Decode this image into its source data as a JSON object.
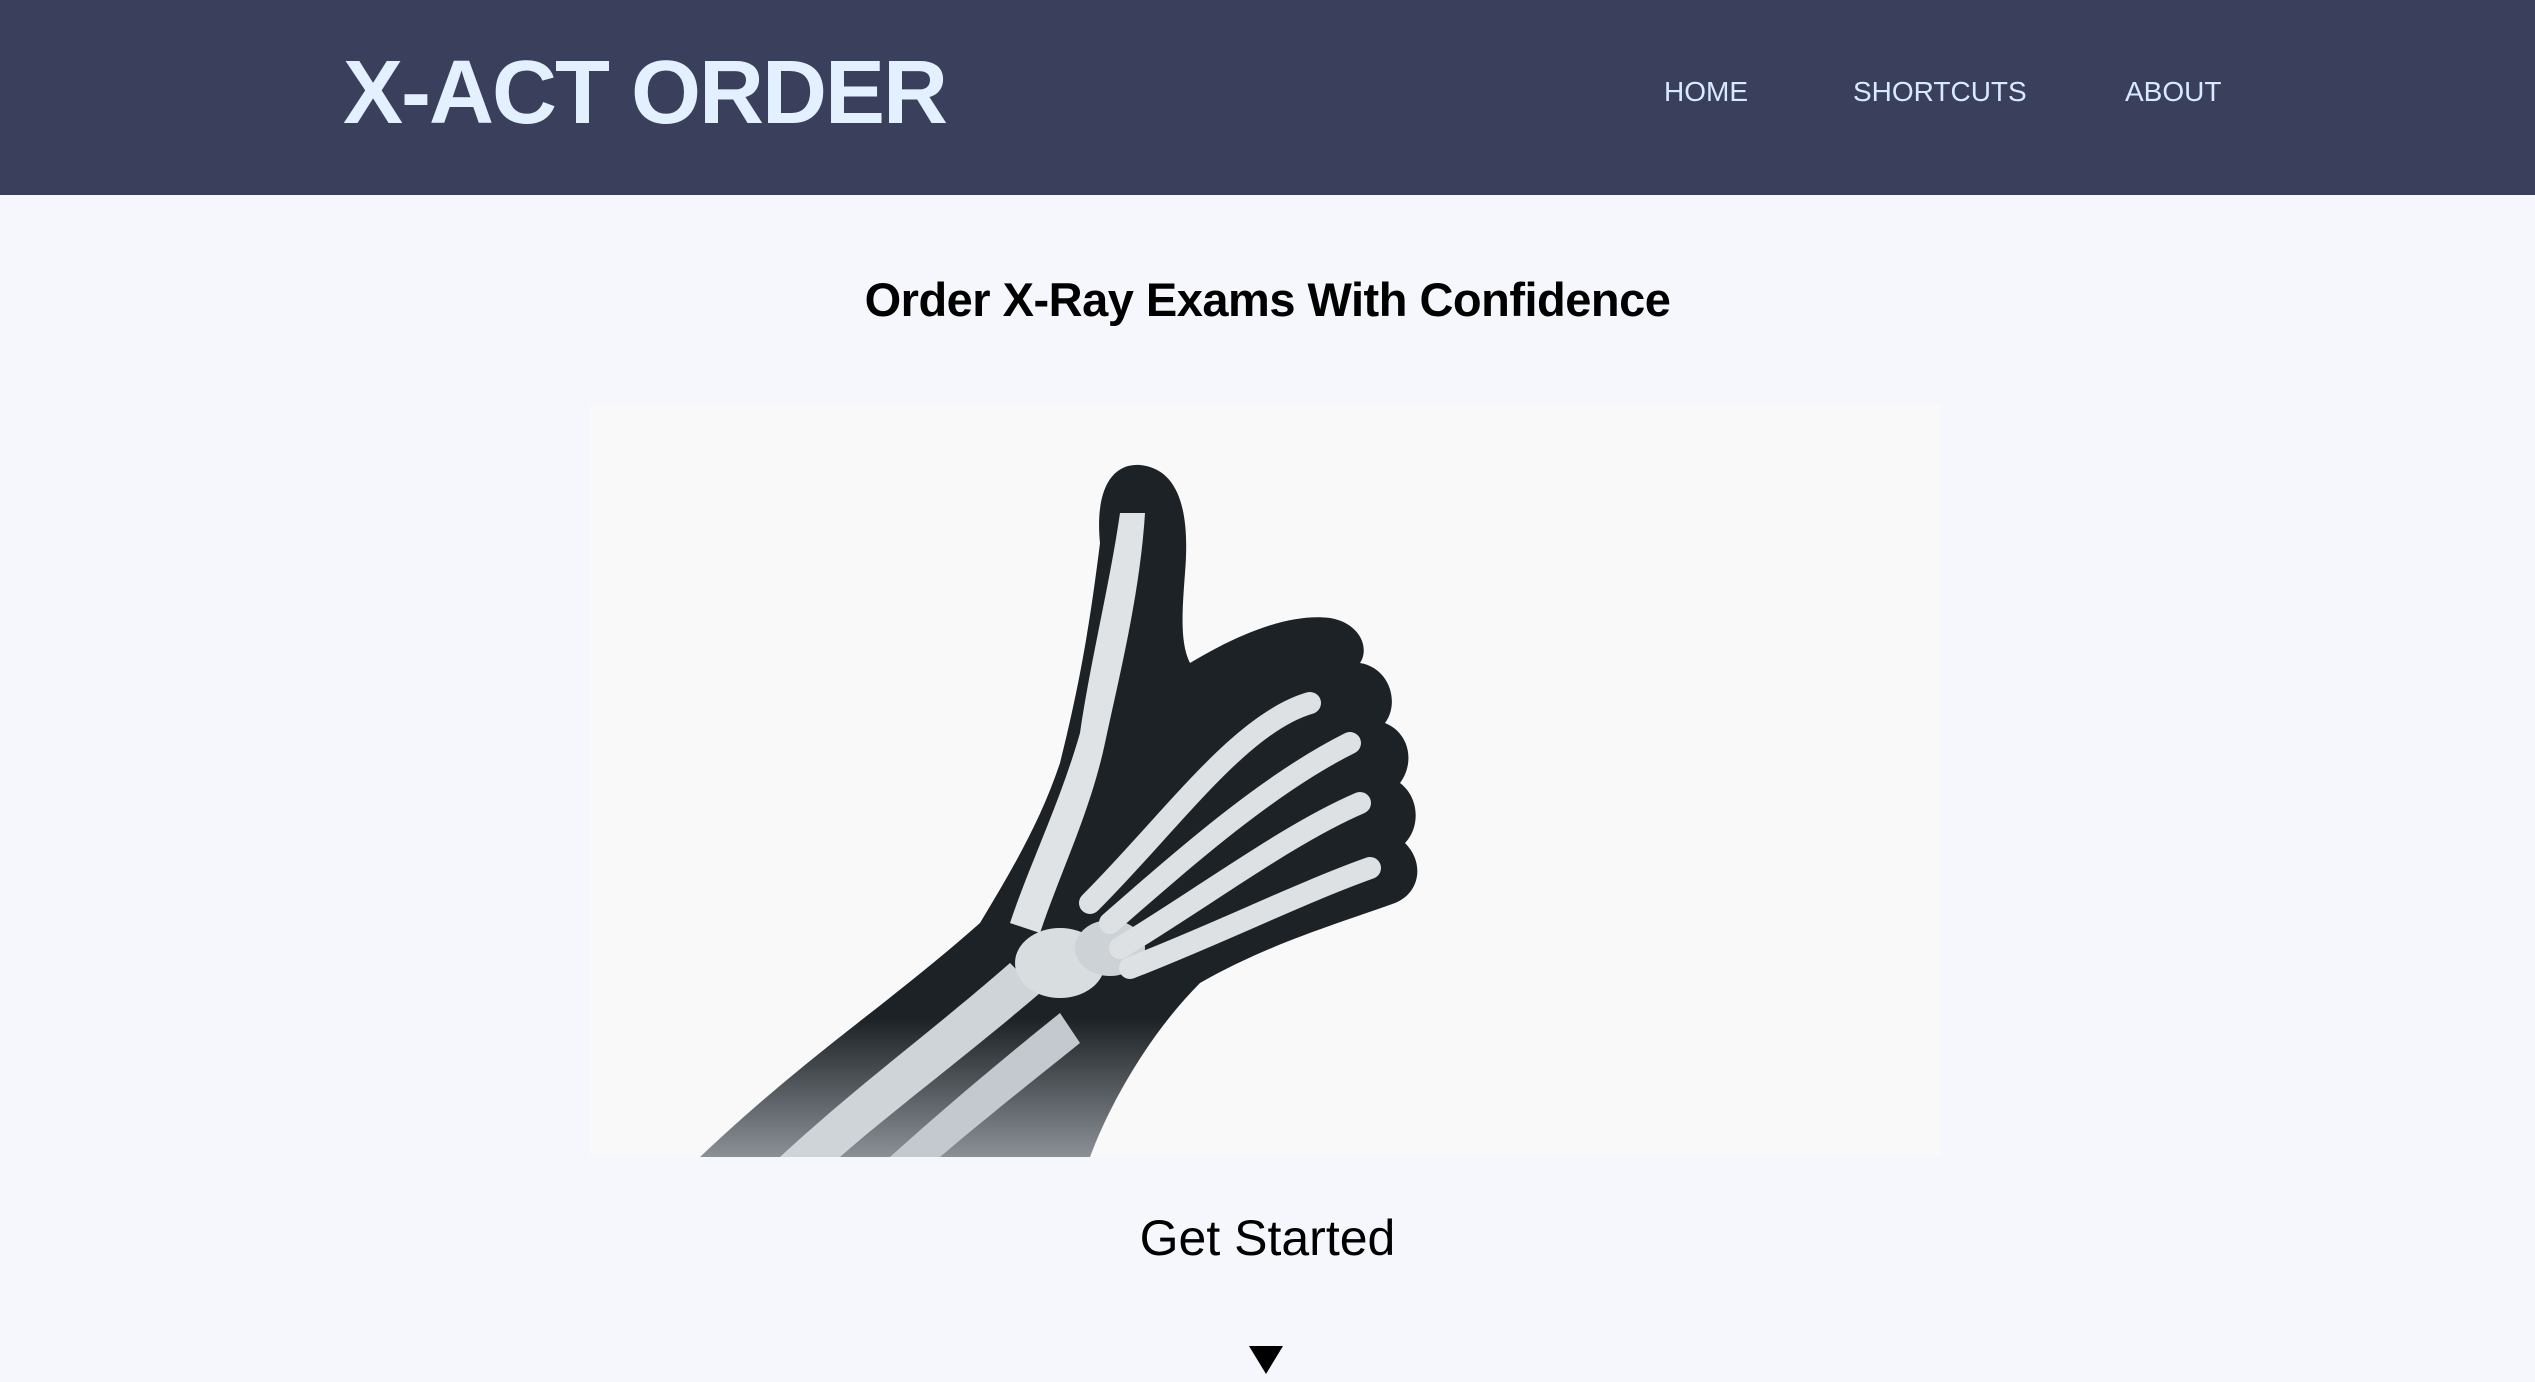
{
  "header": {
    "logo": "X-ACT ORDER",
    "nav": [
      {
        "label": "HOME"
      },
      {
        "label": "SHORTCUTS"
      },
      {
        "label": "ABOUT"
      }
    ],
    "background_color": "#3a3f5c",
    "text_color": "#e3f0ff"
  },
  "main": {
    "title": "Order X-Ray Exams With Confidence",
    "hero_image": "thumbs-up-hand-xray",
    "cta_label": "Get Started",
    "scroll_icon": "triangle-down-icon"
  }
}
